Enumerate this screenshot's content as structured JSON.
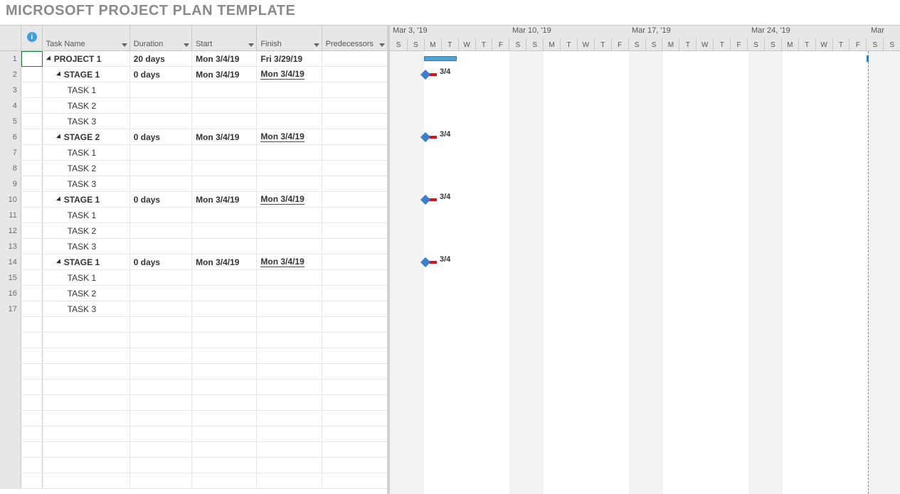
{
  "title": "MICROSOFT PROJECT PLAN TEMPLATE",
  "columns": {
    "taskName": "Task Name",
    "duration": "Duration",
    "start": "Start",
    "finish": "Finish",
    "predecessors": "Predecessors"
  },
  "rows": [
    {
      "n": "1",
      "name": "PROJECT 1",
      "dur": "20 days",
      "start": "Mon 3/4/19",
      "finish": "Fri 3/29/19",
      "level": 0,
      "bold": true,
      "toggle": true,
      "underlineFinish": false,
      "bar": {
        "startCol": 2,
        "len": 2
      },
      "fullSpan": true
    },
    {
      "n": "2",
      "name": "STAGE 1",
      "dur": "0 days",
      "start": "Mon 3/4/19",
      "finish": "Mon 3/4/19",
      "level": 1,
      "bold": true,
      "toggle": true,
      "underlineFinish": true,
      "milestone": {
        "startCol": 2,
        "label": "3/4"
      }
    },
    {
      "n": "3",
      "name": "TASK 1",
      "dur": "",
      "start": "",
      "finish": "",
      "level": 2
    },
    {
      "n": "4",
      "name": "TASK 2",
      "dur": "",
      "start": "",
      "finish": "",
      "level": 2
    },
    {
      "n": "5",
      "name": "TASK 3",
      "dur": "",
      "start": "",
      "finish": "",
      "level": 2
    },
    {
      "n": "6",
      "name": "STAGE 2",
      "dur": "0 days",
      "start": "Mon 3/4/19",
      "finish": "Mon 3/4/19",
      "level": 1,
      "bold": true,
      "toggle": true,
      "underlineFinish": true,
      "milestone": {
        "startCol": 2,
        "label": "3/4"
      }
    },
    {
      "n": "7",
      "name": "TASK 1",
      "dur": "",
      "start": "",
      "finish": "",
      "level": 2
    },
    {
      "n": "8",
      "name": "TASK 2",
      "dur": "",
      "start": "",
      "finish": "",
      "level": 2
    },
    {
      "n": "9",
      "name": "TASK 3",
      "dur": "",
      "start": "",
      "finish": "",
      "level": 2
    },
    {
      "n": "10",
      "name": "STAGE 1",
      "dur": "0 days",
      "start": "Mon 3/4/19",
      "finish": "Mon 3/4/19",
      "level": 1,
      "bold": true,
      "toggle": true,
      "underlineFinish": true,
      "milestone": {
        "startCol": 2,
        "label": "3/4"
      }
    },
    {
      "n": "11",
      "name": "TASK 1",
      "dur": "",
      "start": "",
      "finish": "",
      "level": 2
    },
    {
      "n": "12",
      "name": "TASK 2",
      "dur": "",
      "start": "",
      "finish": "",
      "level": 2
    },
    {
      "n": "13",
      "name": "TASK 3",
      "dur": "",
      "start": "",
      "finish": "",
      "level": 2
    },
    {
      "n": "14",
      "name": "STAGE 1",
      "dur": "0 days",
      "start": "Mon 3/4/19",
      "finish": "Mon 3/4/19",
      "level": 1,
      "bold": true,
      "toggle": true,
      "underlineFinish": true,
      "milestone": {
        "startCol": 2,
        "label": "3/4"
      }
    },
    {
      "n": "15",
      "name": "TASK 1",
      "dur": "",
      "start": "",
      "finish": "",
      "level": 2
    },
    {
      "n": "16",
      "name": "TASK 2",
      "dur": "",
      "start": "",
      "finish": "",
      "level": 2
    },
    {
      "n": "17",
      "name": "TASK 3",
      "dur": "",
      "start": "",
      "finish": "",
      "level": 2
    }
  ],
  "emptyRows": 11,
  "timeline": {
    "dayWidth": 24,
    "weeks": [
      "Mar 3, '19",
      "Mar 10, '19",
      "Mar 17, '19",
      "Mar 24, '19",
      "Mar"
    ],
    "dayPattern": [
      "S",
      "S",
      "M",
      "T",
      "W",
      "T",
      "F"
    ],
    "totalDays": 30,
    "weekendCols": [
      0,
      1,
      7,
      8,
      14,
      15,
      21,
      22,
      28,
      29
    ],
    "todayCol": 28
  }
}
